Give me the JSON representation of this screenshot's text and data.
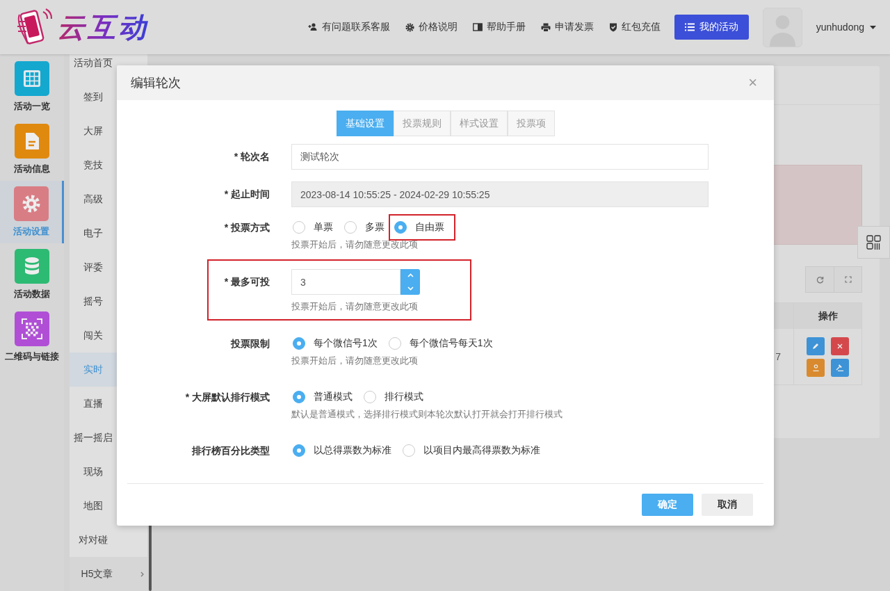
{
  "header": {
    "logo_text": "云互动",
    "links": [
      {
        "label": "有问题联系客服"
      },
      {
        "label": "价格说明"
      },
      {
        "label": "帮助手册"
      },
      {
        "label": "申请发票"
      },
      {
        "label": "红包充值"
      }
    ],
    "primary_button": "我的活动",
    "username": "yunhudong"
  },
  "sidebar": {
    "items": [
      {
        "label": "活动一览",
        "color": "#14a8cf",
        "selected": false
      },
      {
        "label": "活动信息",
        "color": "#e0890f",
        "selected": false
      },
      {
        "label": "活动设置",
        "color": "#d97d85",
        "selected": true
      },
      {
        "label": "活动数据",
        "color": "#2dba73",
        "selected": false
      },
      {
        "label": "二维码与链接",
        "color": "#b04fd6",
        "selected": false
      }
    ]
  },
  "subnav": {
    "items": [
      {
        "label": "活动首页",
        "selected": false
      },
      {
        "label": "签到",
        "selected": false
      },
      {
        "label": "大屏",
        "selected": false
      },
      {
        "label": "竞技",
        "selected": false
      },
      {
        "label": "高级",
        "selected": false
      },
      {
        "label": "电子",
        "selected": false
      },
      {
        "label": "评委",
        "selected": false
      },
      {
        "label": "摇号",
        "selected": false
      },
      {
        "label": "闯关",
        "selected": false
      },
      {
        "label": "实时",
        "selected": true
      },
      {
        "label": "直播",
        "selected": false
      },
      {
        "label": "摇一摇启",
        "selected": false
      },
      {
        "label": "现场",
        "selected": false
      },
      {
        "label": "地图",
        "selected": false
      },
      {
        "label": "对对碰",
        "selected": false
      },
      {
        "label": "H5文章",
        "selected": false,
        "has_children": true
      }
    ]
  },
  "background_table": {
    "header": "操作",
    "cell": "7"
  },
  "dialog": {
    "title": "编辑轮次",
    "close": "×",
    "tabs": [
      {
        "label": "基础设置",
        "selected": true
      },
      {
        "label": "投票规则",
        "selected": false
      },
      {
        "label": "样式设置",
        "selected": false
      },
      {
        "label": "投票项",
        "selected": false
      }
    ],
    "fields": [
      {
        "kind": "text",
        "label": "* 轮次名",
        "value": "测试轮次",
        "disabled": false
      },
      {
        "kind": "text",
        "label": "* 起止时间",
        "value": "2023-08-14 10:55:25 - 2024-02-29 10:55:25",
        "disabled": true
      },
      {
        "kind": "radio",
        "label": "* 投票方式",
        "options": [
          {
            "label": "单票",
            "selected": false,
            "highlighted": false
          },
          {
            "label": "多票",
            "selected": false,
            "highlighted": false
          },
          {
            "label": "自由票",
            "selected": true,
            "highlighted": true
          }
        ],
        "hint": "投票开始后，请勿随意更改此项"
      },
      {
        "kind": "number",
        "label": "* 最多可投",
        "value": "3",
        "hint": "投票开始后，请勿随意更改此项",
        "highlighted": true
      },
      {
        "kind": "radio",
        "label": "投票限制",
        "options": [
          {
            "label": "每个微信号1次",
            "selected": true,
            "highlighted": false
          },
          {
            "label": "每个微信号每天1次",
            "selected": false,
            "highlighted": false
          }
        ],
        "hint": "投票开始后，请勿随意更改此项"
      },
      {
        "kind": "radio",
        "label": "* 大屏默认排行模式",
        "options": [
          {
            "label": "普通模式",
            "selected": true,
            "highlighted": false
          },
          {
            "label": "排行模式",
            "selected": false,
            "highlighted": false
          }
        ],
        "hint": "默认是普通模式，选择排行模式则本轮次默认打开就会打开排行模式"
      },
      {
        "kind": "radio",
        "label": "排行榜百分比类型",
        "options": [
          {
            "label": "以总得票数为标准",
            "selected": true,
            "highlighted": false
          },
          {
            "label": "以项目内最高得票数为标准",
            "selected": false,
            "highlighted": false
          }
        ]
      }
    ],
    "buttons": [
      {
        "label": "确定",
        "kind": "primary"
      },
      {
        "label": "取消",
        "kind": "default"
      }
    ]
  }
}
